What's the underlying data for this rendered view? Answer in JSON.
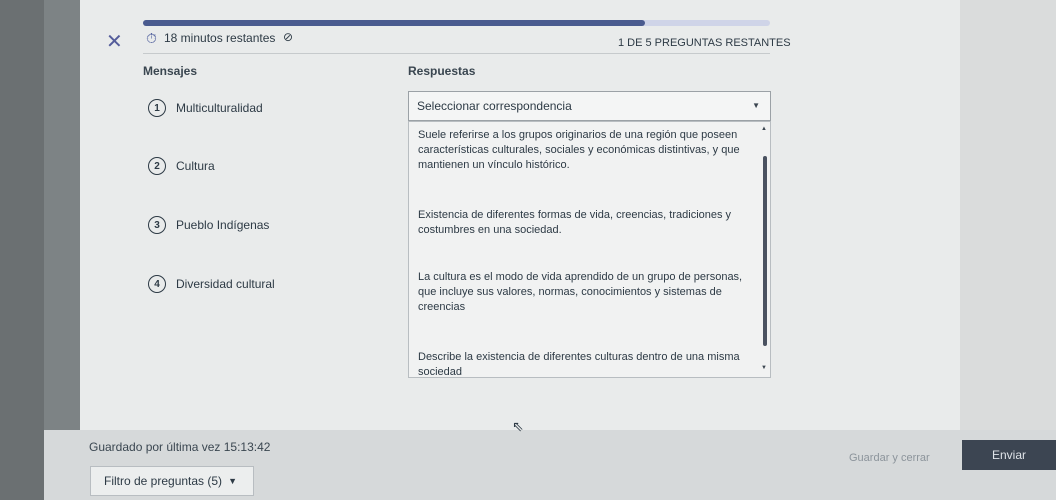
{
  "header": {
    "timer_text": "18 minutos restantes",
    "progress_label": "1 DE 5 PREGUNTAS RESTANTES",
    "progress_fraction": 0.8
  },
  "columns": {
    "messages": "Mensajes",
    "answers": "Respuestas"
  },
  "messages": [
    {
      "number": "1",
      "label": "Multiculturalidad"
    },
    {
      "number": "2",
      "label": "Cultura"
    },
    {
      "number": "3",
      "label": "Pueblo Indígenas"
    },
    {
      "number": "4",
      "label": "Diversidad cultural"
    }
  ],
  "select": {
    "placeholder": "Seleccionar correspondencia"
  },
  "options": [
    "Suele referirse a los grupos originarios de una región que poseen características culturales, sociales y económicas distintivas, y que mantienen un vínculo histórico.",
    "Existencia de diferentes formas de vida, creencias, tradiciones y costumbres en una sociedad.",
    "La cultura es el modo de vida aprendido de un grupo de personas, que incluye sus valores, normas, conocimientos y sistemas de creencias",
    "Describe la existencia de diferentes culturas dentro de una misma sociedad"
  ],
  "footer": {
    "saved_text": "Guardado por última vez 15:13:42",
    "filter_label": "Filtro de preguntas (5)",
    "save_close_label": "Guardar y cerrar",
    "submit_label": "Enviar"
  },
  "colors": {
    "accent": "#4a5b8f",
    "progress_track": "#cfd4e8",
    "submit_bg": "#3c4552"
  }
}
